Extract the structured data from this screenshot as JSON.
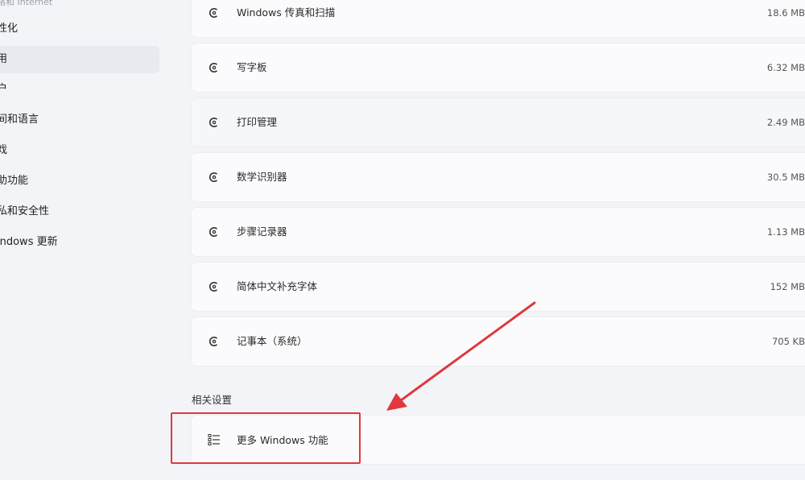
{
  "sidebar": {
    "items": [
      {
        "label": "络和 Internet",
        "faded": true
      },
      {
        "label": "性化"
      },
      {
        "label": "用",
        "active": true
      },
      {
        "label": "户"
      },
      {
        "label": "间和语言"
      },
      {
        "label": "戏"
      },
      {
        "label": "助功能"
      },
      {
        "label": "私和安全性"
      },
      {
        "label": "indows 更新"
      }
    ]
  },
  "apps": [
    {
      "name": "Windows 传真和扫描",
      "size": "18.6 MB",
      "icon": "gear-icon"
    },
    {
      "name": "写字板",
      "size": "6.32 MB",
      "icon": "gear-icon"
    },
    {
      "name": "打印管理",
      "size": "2.49 MB",
      "icon": "gear-icon"
    },
    {
      "name": "数学识别器",
      "size": "30.5 MB",
      "icon": "gear-icon"
    },
    {
      "name": "步骤记录器",
      "size": "1.13 MB",
      "icon": "gear-icon"
    },
    {
      "name": "简体中文补充字体",
      "size": "152 MB",
      "icon": "gear-icon"
    },
    {
      "name": "记事本（系统）",
      "size": "705 KB",
      "icon": "gear-icon"
    }
  ],
  "related": {
    "title": "相关设置",
    "more_label": "更多 Windows 功能",
    "more_icon": "list-icon"
  },
  "colors": {
    "background": "#f3f4f8",
    "card": "#fbfbfd",
    "highlight": "#e0383c"
  }
}
